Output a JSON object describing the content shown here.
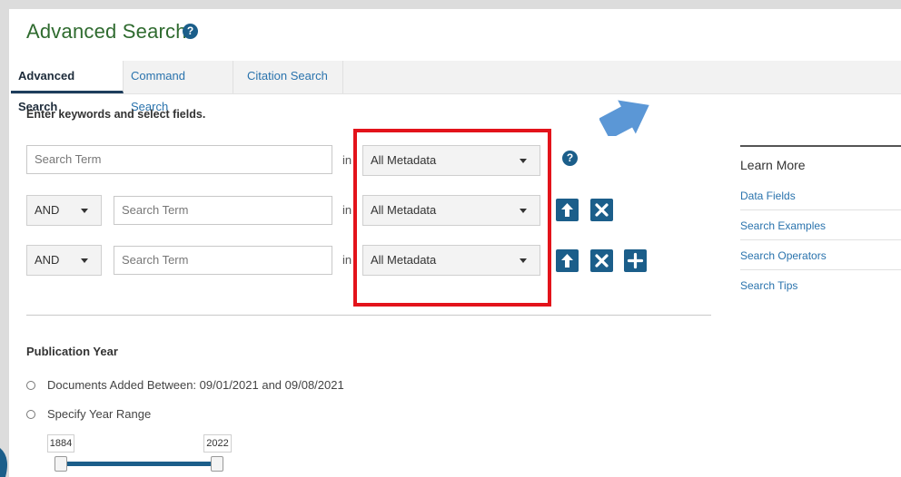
{
  "page": {
    "title": "Advanced Search",
    "title_help_glyph": "?"
  },
  "tabs": [
    {
      "label": "Advanced Search",
      "active": true
    },
    {
      "label": "Command Search",
      "active": false
    },
    {
      "label": "Citation Search",
      "active": false
    }
  ],
  "instructions": "Enter keywords and select fields.",
  "search_rows": [
    {
      "operator": null,
      "term_placeholder": "Search Term",
      "in_label": "in",
      "field": "All Metadata",
      "actions": [
        "help-icon"
      ]
    },
    {
      "operator": "AND",
      "term_placeholder": "Search Term",
      "in_label": "in",
      "field": "All Metadata",
      "actions": [
        "arrow-up-icon",
        "close-icon"
      ]
    },
    {
      "operator": "AND",
      "term_placeholder": "Search Term",
      "in_label": "in",
      "field": "All Metadata",
      "actions": [
        "arrow-up-icon",
        "close-icon",
        "plus-icon"
      ]
    }
  ],
  "learn_more": {
    "title": "Learn More",
    "links": [
      "Data Fields",
      "Search Examples",
      "Search Operators",
      "Search Tips"
    ]
  },
  "publication_year": {
    "title": "Publication Year",
    "options": [
      "Documents Added Between: 09/01/2021 and 09/08/2021",
      "Specify Year Range"
    ],
    "range": {
      "from": "1884",
      "to": "2022"
    }
  },
  "colors": {
    "accent_blue": "#1b5e8a",
    "link_blue": "#2a73ad",
    "title_green": "#2f6b2f",
    "annotation_red": "#e3131b",
    "annotation_arrow": "#5b97d6"
  }
}
